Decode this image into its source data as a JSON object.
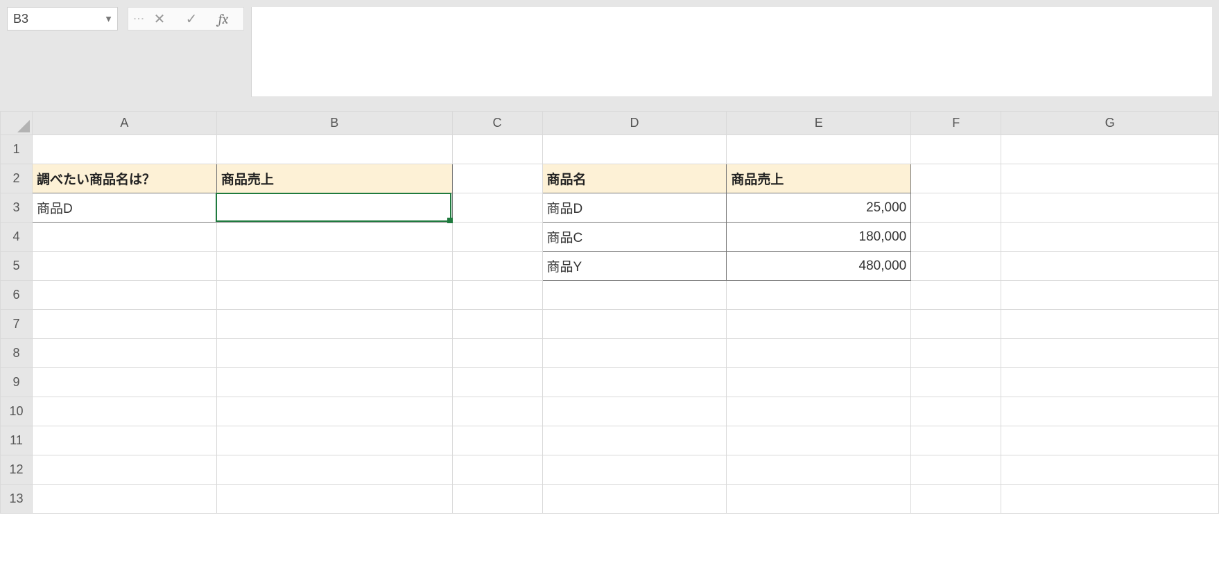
{
  "nameBox": {
    "value": "B3"
  },
  "fx": {
    "label": "fx",
    "formula": ""
  },
  "columns": [
    "A",
    "B",
    "C",
    "D",
    "E",
    "F",
    "G"
  ],
  "rows": [
    "1",
    "2",
    "3",
    "4",
    "5",
    "6",
    "7",
    "8",
    "9",
    "10",
    "11",
    "12",
    "13"
  ],
  "cells": {
    "A2": "調べたい商品名は？",
    "B2": "商品売上",
    "A3": "商品D",
    "B3": "",
    "D2": "商品名",
    "E2": "商品売上",
    "D3": "商品D",
    "E3": "25,000",
    "D4": "商品C",
    "E4": "180,000",
    "D5": "商品Y",
    "E5": "480,000"
  },
  "activeCell": {
    "col": "B",
    "row": 3
  }
}
